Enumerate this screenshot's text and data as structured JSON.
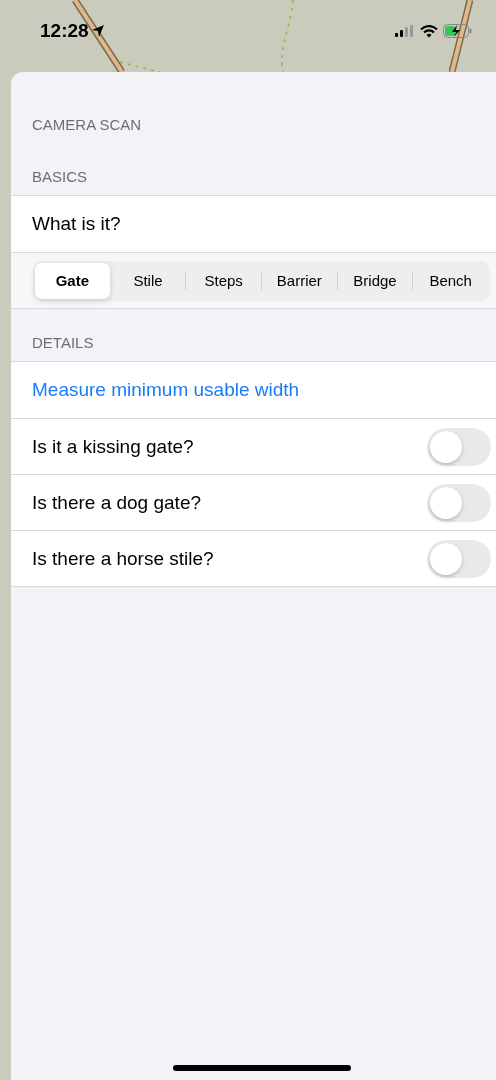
{
  "status_bar": {
    "time": "12:28"
  },
  "sheet": {
    "title": "CAMERA SCAN",
    "sections": [
      {
        "header": "BASICS",
        "rows": [
          {
            "kind": "label",
            "text": "What is it?"
          },
          {
            "kind": "segmented",
            "segments": [
              {
                "label": "Gate",
                "selected": true
              },
              {
                "label": "Stile",
                "selected": false
              },
              {
                "label": "Steps",
                "selected": false
              },
              {
                "label": "Barrier",
                "selected": false
              },
              {
                "label": "Bridge",
                "selected": false
              },
              {
                "label": "Bench",
                "selected": false
              }
            ]
          }
        ]
      },
      {
        "header": "DETAILS",
        "rows": [
          {
            "kind": "link",
            "text": "Measure minimum usable width"
          },
          {
            "kind": "toggle",
            "text": "Is it a kissing gate?",
            "on": false
          },
          {
            "kind": "toggle",
            "text": "Is there a dog gate?",
            "on": false
          },
          {
            "kind": "toggle",
            "text": "Is there a horse stile?",
            "on": false
          }
        ]
      }
    ]
  }
}
